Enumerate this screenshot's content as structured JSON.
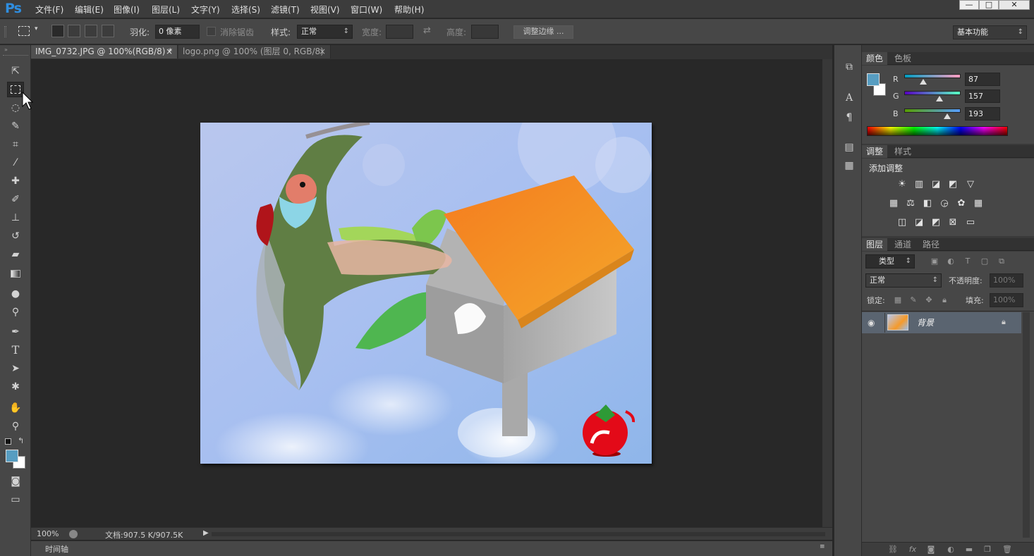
{
  "app": {
    "logo": "Ps"
  },
  "menu": [
    "文件(F)",
    "编辑(E)",
    "图像(I)",
    "图层(L)",
    "文字(Y)",
    "选择(S)",
    "滤镜(T)",
    "视图(V)",
    "窗口(W)",
    "帮助(H)"
  ],
  "window_controls": {
    "minimize": "—",
    "maximize": "□",
    "close": "✕"
  },
  "options": {
    "feather_label": "羽化:",
    "feather_value": "0 像素",
    "antialias_label": "消除锯齿",
    "style_label": "样式:",
    "style_value": "正常",
    "width_label": "宽度:",
    "height_label": "高度:",
    "refine_edge": "调整边缘 ...",
    "workspace": "基本功能"
  },
  "tabs": [
    {
      "label": "IMG_0732.JPG @ 100%(RGB/8) *",
      "close": "×"
    },
    {
      "label": "logo.png @ 100% (图层 0, RGB/8)",
      "close": "×"
    }
  ],
  "status": {
    "zoom": "100%",
    "doc": "文档:907.5 K/907.5K",
    "arrow": "▶"
  },
  "timeline": {
    "label": "时间轴"
  },
  "color_panel": {
    "tabs": [
      "颜色",
      "色板"
    ],
    "channels": [
      {
        "label": "R",
        "value": "87",
        "fraction": 0.34
      },
      {
        "label": "G",
        "value": "157",
        "fraction": 0.62
      },
      {
        "label": "B",
        "value": "193",
        "fraction": 0.76
      }
    ],
    "fg_color": "#579dc1",
    "bg_color": "#ffffff"
  },
  "adjust_panel": {
    "tabs": [
      "调整",
      "样式"
    ],
    "title": "添加调整"
  },
  "layers_panel": {
    "tabs": [
      "图层",
      "通道",
      "路径"
    ],
    "filter": "类型",
    "blend": "正常",
    "opacity_label": "不透明度:",
    "opacity_value": "100%",
    "lock_label": "锁定:",
    "fill_label": "填充:",
    "fill_value": "100%",
    "layer_name": "背景"
  },
  "icons": {
    "tools": [
      "move-icon",
      "marquee-icon",
      "lasso-icon",
      "quick-select-icon",
      "crop-icon",
      "eyedropper-icon",
      "healing-brush-icon",
      "brush-icon",
      "clone-stamp-icon",
      "history-brush-icon",
      "eraser-icon",
      "gradient-icon",
      "blur-icon",
      "dodge-icon",
      "pen-icon",
      "type-icon",
      "path-select-icon",
      "shape-icon",
      "hand-icon",
      "zoom-icon"
    ]
  }
}
